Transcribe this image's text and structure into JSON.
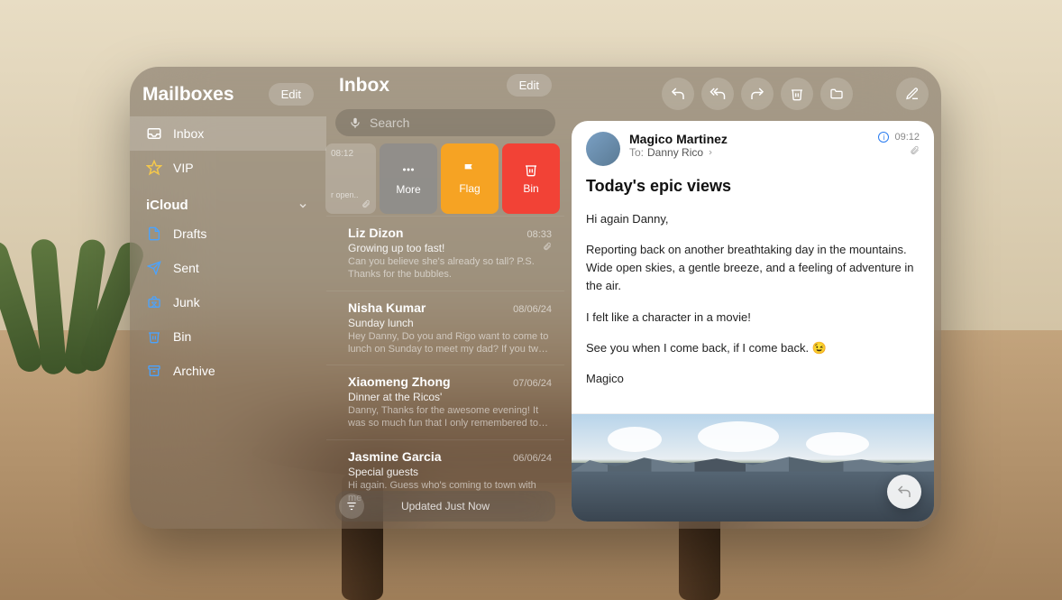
{
  "sidebar": {
    "title": "Mailboxes",
    "edit_label": "Edit",
    "top_items": [
      {
        "id": "inbox",
        "label": "Inbox",
        "icon": "tray",
        "color": "#ffffff",
        "selected": true
      },
      {
        "id": "vip",
        "label": "VIP",
        "icon": "star",
        "color": "#f5c84b",
        "selected": false
      }
    ],
    "section_label": "iCloud",
    "account_items": [
      {
        "id": "drafts",
        "label": "Drafts",
        "icon": "doc",
        "color": "#4aa3ff"
      },
      {
        "id": "sent",
        "label": "Sent",
        "icon": "plane",
        "color": "#4aa3ff"
      },
      {
        "id": "junk",
        "label": "Junk",
        "icon": "junkbox",
        "color": "#4aa3ff"
      },
      {
        "id": "bin",
        "label": "Bin",
        "icon": "trash",
        "color": "#4aa3ff"
      },
      {
        "id": "archive",
        "label": "Archive",
        "icon": "archive",
        "color": "#4aa3ff"
      }
    ]
  },
  "list": {
    "title": "Inbox",
    "edit_label": "Edit",
    "search_placeholder": "Search",
    "swipe": {
      "hidden_time": "08:12",
      "hidden_preview": "r open..",
      "more_label": "More",
      "flag_label": "Flag",
      "bin_label": "Bin"
    },
    "messages": [
      {
        "from": "Liz Dizon",
        "time": "08:33",
        "subject": "Growing up too fast!",
        "preview": "Can you believe she's already so tall? P.S. Thanks for the bubbles.",
        "attachment": true
      },
      {
        "from": "Nisha Kumar",
        "time": "08/06/24",
        "subject": "Sunday lunch",
        "preview": "Hey Danny, Do you and Rigo want to come to lunch on Sunday to meet my dad? If you two j...",
        "attachment": false
      },
      {
        "from": "Xiaomeng Zhong",
        "time": "07/06/24",
        "subject": "Dinner at the Ricos'",
        "preview": "Danny, Thanks for the awesome evening! It was so much fun that I only remembered to take o...",
        "attachment": false
      },
      {
        "from": "Jasmine Garcia",
        "time": "06/06/24",
        "subject": "Special guests",
        "preview": "Hi again. Guess who's coming to town with me",
        "attachment": false
      }
    ],
    "status": "Updated Just Now"
  },
  "toolbar": {
    "reply": "Reply",
    "reply_all": "Reply All",
    "forward": "Forward",
    "trash": "Trash",
    "move": "Move",
    "compose": "Compose"
  },
  "reader": {
    "from": "Magico Martinez",
    "to_label": "To:",
    "to_name": "Danny Rico",
    "time": "09:12",
    "subject": "Today's epic views",
    "paragraphs": [
      "Hi again Danny,",
      "Reporting back on another breathtaking day in the mountains. Wide open skies, a gentle breeze, and a feeling of adventure in the air.",
      "I felt like a character in a movie!",
      "See you when I come back, if I come back. 😉",
      "Magico"
    ]
  }
}
